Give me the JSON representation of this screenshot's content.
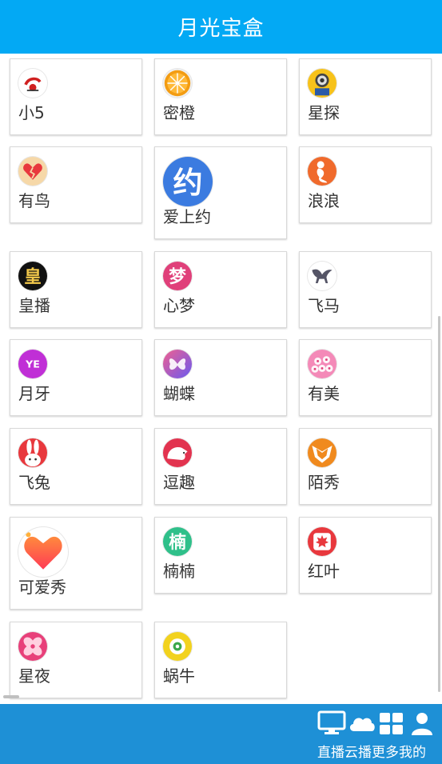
{
  "header": {
    "title": "月光宝盒"
  },
  "apps": [
    {
      "label": "小5",
      "icon": "xiao5-logo-icon",
      "color": "#ffffff"
    },
    {
      "label": "密橙",
      "icon": "orange-slice-icon",
      "color": "#f39c12"
    },
    {
      "label": "星探",
      "icon": "minion-icon",
      "color": "#f7c21a"
    },
    {
      "label": "有鸟",
      "icon": "broken-heart-icon",
      "color": "#f2c27a"
    },
    {
      "label": "爱上约",
      "icon": "yue-character-icon",
      "color": "#3b7be0",
      "glyph": "约"
    },
    {
      "label": "浪浪",
      "icon": "mermaid-icon",
      "color": "#f06a2c"
    },
    {
      "label": "皇播",
      "icon": "huang-character-icon",
      "color": "#111111",
      "glyph": "皇"
    },
    {
      "label": "心梦",
      "icon": "meng-character-icon",
      "color": "#e0407a",
      "glyph": "梦"
    },
    {
      "label": "飞马",
      "icon": "pegasus-icon",
      "color": "#ffffff"
    },
    {
      "label": "月牙",
      "icon": "ye-logo-icon",
      "color": "#c02fd6",
      "glyph": "YE"
    },
    {
      "label": "蝴蝶",
      "icon": "butterfly-icon",
      "color": "#8a4fe0"
    },
    {
      "label": "有美",
      "icon": "blossom-icon",
      "color": "#f07ab0"
    },
    {
      "label": "飞兔",
      "icon": "rabbit-icon",
      "color": "#e8383d"
    },
    {
      "label": "逗趣",
      "icon": "hedgehog-icon",
      "color": "#e2334f"
    },
    {
      "label": "陌秀",
      "icon": "fox-icon",
      "color": "#f08a1e"
    },
    {
      "label": "可爱秀",
      "icon": "heart-icon",
      "color": "#ff6a3d"
    },
    {
      "label": "楠楠",
      "icon": "nan-character-icon",
      "color": "#2fc08a",
      "glyph": "楠"
    },
    {
      "label": "红叶",
      "icon": "maple-leaf-icon",
      "color": "#e8383d"
    },
    {
      "label": "星夜",
      "icon": "flower-logo-icon",
      "color": "#e8407a"
    },
    {
      "label": "蜗牛",
      "icon": "snail-icon",
      "color": "#f2d21e"
    }
  ],
  "bottom_nav": [
    {
      "label": "直播",
      "icon": "monitor-icon"
    },
    {
      "label": "云播",
      "icon": "cloud-icon"
    },
    {
      "label": "更多",
      "icon": "grid-icon"
    },
    {
      "label": "我的",
      "icon": "user-icon"
    }
  ]
}
